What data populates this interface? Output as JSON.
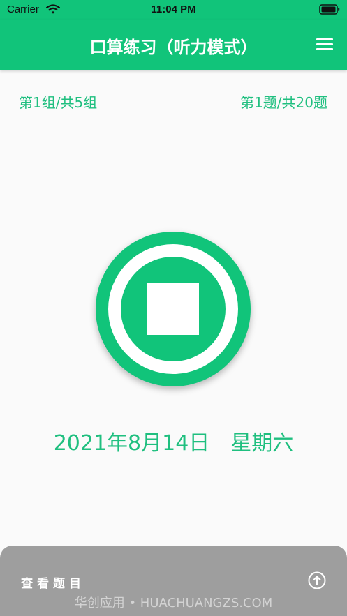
{
  "status_bar": {
    "carrier": "Carrier",
    "time": "11:04 PM",
    "wifi_icon": "wifi-icon",
    "battery_icon": "battery-icon"
  },
  "nav": {
    "title": "口算练习（听力模式）",
    "menu_icon": "menu-icon"
  },
  "progress": {
    "group": "第1组/共5组",
    "question": "第1题/共20题"
  },
  "control": {
    "icon": "stop-icon"
  },
  "date": {
    "text": "2021年8月14日　星期六"
  },
  "bottom_panel": {
    "label": "查看题目",
    "icon": "arrow-up-circle-icon",
    "watermark": "华创应用 • HUACHUANGZS.COM"
  },
  "colors": {
    "brand_green": "#11c47a",
    "text_green": "#1fbf7f",
    "panel_gray": "#9e9e9e",
    "background": "#fafafa"
  }
}
